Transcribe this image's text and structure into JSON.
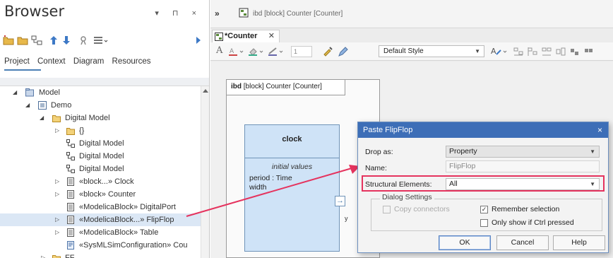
{
  "browser": {
    "title": "Browser",
    "controls": "▾ ⊓ ×",
    "tabs": [
      "Project",
      "Context",
      "Diagram",
      "Resources"
    ],
    "tree": [
      {
        "label": "Model",
        "icon": "model-package-icon",
        "toggle": "◢"
      },
      {
        "label": "Demo",
        "icon": "package-icon",
        "toggle": "◢"
      },
      {
        "label": "Digital Model",
        "icon": "folder-icon",
        "toggle": "◢"
      },
      {
        "label": "{}",
        "icon": "folder-icon",
        "toggle": "▷"
      },
      {
        "label": "Digital Model",
        "icon": "diagram-icon",
        "toggle": ""
      },
      {
        "label": "Digital Model",
        "icon": "diagram-icon",
        "toggle": ""
      },
      {
        "label": "Digital Model",
        "icon": "diagram-icon",
        "toggle": ""
      },
      {
        "label": "«block...» Clock",
        "icon": "block-icon",
        "toggle": "▷"
      },
      {
        "label": "«block» Counter",
        "icon": "block-icon",
        "toggle": "▷"
      },
      {
        "label": "«ModelicaBlock» DigitalPort",
        "icon": "block-icon",
        "toggle": ""
      },
      {
        "label": "«ModelicaBlock...» FlipFlop",
        "icon": "block-icon",
        "toggle": "▷"
      },
      {
        "label": "«ModelicaBlock» Table",
        "icon": "block-icon",
        "toggle": "▷"
      },
      {
        "label": "«SysMLSimConfiguration» Cou",
        "icon": "config-icon",
        "toggle": ""
      },
      {
        "label": "FF",
        "icon": "folder-icon",
        "toggle": "▷"
      }
    ]
  },
  "diagram": {
    "top_title": "ibd [block] Counter [Counter]",
    "tab_label": "*Counter",
    "tab_close": "✕",
    "style_select": "Default Style",
    "frame_label_kind": "ibd",
    "frame_label_rest": " [block] Counter [Counter]",
    "part_name": "clock",
    "initial_values": "initial values",
    "prop1": "period : Time",
    "prop2": "width",
    "port_label": "y",
    "port_glyph": "→"
  },
  "dialog": {
    "title": "Paste FlipFlop",
    "close": "×",
    "drop_as_label": "Drop as:",
    "drop_as_value": "Property",
    "name_label": "Name:",
    "name_value": "FlipFlop",
    "structural_label": "Structural Elements:",
    "structural_value": "All",
    "group_title": "Dialog Settings",
    "copy_connectors": "Copy connectors",
    "copy_connectors_checked": false,
    "remember_selection": "Remember selection",
    "remember_selection_checked": true,
    "only_ctrl": "Only show if Ctrl pressed",
    "only_ctrl_checked": false,
    "ok": "OK",
    "cancel": "Cancel",
    "help": "Help"
  },
  "colors": {
    "accent": "#3d6eb7",
    "highlight": "#e5335e",
    "block_fill": "#cfe3f7"
  }
}
